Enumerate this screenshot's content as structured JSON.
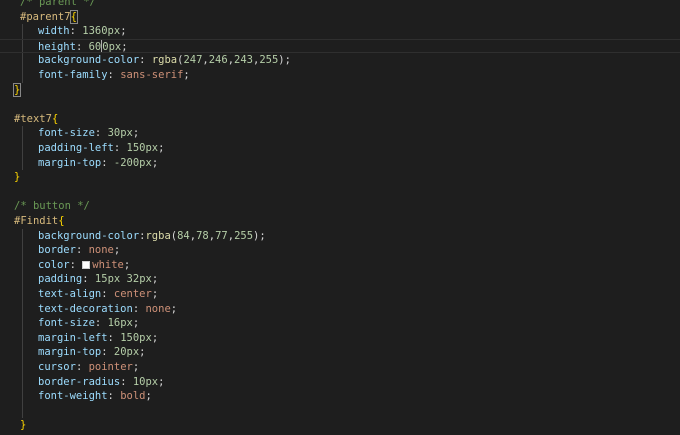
{
  "editor": {
    "lines": [
      {
        "tokens": [
          {
            "t": "/* ",
            "c": "cmt"
          },
          {
            "t": "parent",
            "c": "cmt"
          },
          {
            "t": " */",
            "c": "cmt"
          }
        ]
      },
      {
        "tokens": [
          {
            "t": "#parent7",
            "c": "sel"
          },
          {
            "t": "{",
            "c": "brace"
          }
        ]
      },
      {
        "tokens": [
          {
            "t": "width",
            "c": "prop"
          },
          {
            "t": ": ",
            "c": "punc"
          },
          {
            "t": "1360px",
            "c": "num"
          },
          {
            "t": ";",
            "c": "punc"
          }
        ]
      },
      {
        "tokens": [
          {
            "t": "height",
            "c": "prop"
          },
          {
            "t": ": ",
            "c": "punc"
          },
          {
            "t": "60",
            "c": "num"
          },
          {
            "t": "0px",
            "c": "num"
          },
          {
            "t": ";",
            "c": "punc"
          }
        ]
      },
      {
        "tokens": [
          {
            "t": "background-color",
            "c": "prop"
          },
          {
            "t": ": ",
            "c": "punc"
          },
          {
            "t": "rgba",
            "c": "fn"
          },
          {
            "t": "(",
            "c": "punc"
          },
          {
            "t": "247",
            "c": "num"
          },
          {
            "t": ",",
            "c": "punc"
          },
          {
            "t": "246",
            "c": "num"
          },
          {
            "t": ",",
            "c": "punc"
          },
          {
            "t": "243",
            "c": "num"
          },
          {
            "t": ",",
            "c": "punc"
          },
          {
            "t": "255",
            "c": "num"
          },
          {
            "t": ");",
            "c": "punc"
          }
        ]
      },
      {
        "tokens": [
          {
            "t": "font-family",
            "c": "prop"
          },
          {
            "t": ": ",
            "c": "punc"
          },
          {
            "t": "sans-serif",
            "c": "val"
          },
          {
            "t": ";",
            "c": "punc"
          }
        ]
      },
      {
        "tokens": [
          {
            "t": "}",
            "c": "brace"
          }
        ]
      },
      {
        "tokens": []
      },
      {
        "tokens": [
          {
            "t": "#text7",
            "c": "sel"
          },
          {
            "t": "{",
            "c": "brace"
          }
        ]
      },
      {
        "tokens": [
          {
            "t": "font-size",
            "c": "prop"
          },
          {
            "t": ": ",
            "c": "punc"
          },
          {
            "t": "30px",
            "c": "num"
          },
          {
            "t": ";",
            "c": "punc"
          }
        ]
      },
      {
        "tokens": [
          {
            "t": "padding-left",
            "c": "prop"
          },
          {
            "t": ": ",
            "c": "punc"
          },
          {
            "t": "150px",
            "c": "num"
          },
          {
            "t": ";",
            "c": "punc"
          }
        ]
      },
      {
        "tokens": [
          {
            "t": "margin-top",
            "c": "prop"
          },
          {
            "t": ": ",
            "c": "punc"
          },
          {
            "t": "-200px",
            "c": "num"
          },
          {
            "t": ";",
            "c": "punc"
          }
        ]
      },
      {
        "tokens": [
          {
            "t": "}",
            "c": "brace"
          }
        ]
      },
      {
        "tokens": []
      },
      {
        "tokens": [
          {
            "t": "/* button */",
            "c": "cmt"
          }
        ]
      },
      {
        "tokens": [
          {
            "t": "#Findit",
            "c": "sel"
          },
          {
            "t": "{",
            "c": "brace"
          }
        ]
      },
      {
        "tokens": [
          {
            "t": "background-color",
            "c": "prop"
          },
          {
            "t": ":",
            "c": "punc"
          },
          {
            "t": "rgba",
            "c": "fn"
          },
          {
            "t": "(",
            "c": "punc"
          },
          {
            "t": "84",
            "c": "num"
          },
          {
            "t": ",",
            "c": "punc"
          },
          {
            "t": "78",
            "c": "num"
          },
          {
            "t": ",",
            "c": "punc"
          },
          {
            "t": "77",
            "c": "num"
          },
          {
            "t": ",",
            "c": "punc"
          },
          {
            "t": "255",
            "c": "num"
          },
          {
            "t": ");",
            "c": "punc"
          }
        ]
      },
      {
        "tokens": [
          {
            "t": "border",
            "c": "prop"
          },
          {
            "t": ": ",
            "c": "punc"
          },
          {
            "t": "none",
            "c": "val"
          },
          {
            "t": ";",
            "c": "punc"
          }
        ]
      },
      {
        "tokens": [
          {
            "t": "color",
            "c": "prop"
          },
          {
            "t": ": ",
            "c": "punc"
          },
          {
            "t": "white",
            "c": "val"
          },
          {
            "t": ";",
            "c": "punc"
          }
        ]
      },
      {
        "tokens": [
          {
            "t": "padding",
            "c": "prop"
          },
          {
            "t": ": ",
            "c": "punc"
          },
          {
            "t": "15px",
            "c": "num"
          },
          {
            "t": " ",
            "c": "punc"
          },
          {
            "t": "32px",
            "c": "num"
          },
          {
            "t": ";",
            "c": "punc"
          }
        ]
      },
      {
        "tokens": [
          {
            "t": "text-align",
            "c": "prop"
          },
          {
            "t": ": ",
            "c": "punc"
          },
          {
            "t": "center",
            "c": "val"
          },
          {
            "t": ";",
            "c": "punc"
          }
        ]
      },
      {
        "tokens": [
          {
            "t": "text-decoration",
            "c": "prop"
          },
          {
            "t": ": ",
            "c": "punc"
          },
          {
            "t": "none",
            "c": "val"
          },
          {
            "t": ";",
            "c": "punc"
          }
        ]
      },
      {
        "tokens": [
          {
            "t": "font-size",
            "c": "prop"
          },
          {
            "t": ": ",
            "c": "punc"
          },
          {
            "t": "16px",
            "c": "num"
          },
          {
            "t": ";",
            "c": "punc"
          }
        ]
      },
      {
        "tokens": [
          {
            "t": "margin-left",
            "c": "prop"
          },
          {
            "t": ": ",
            "c": "punc"
          },
          {
            "t": "150px",
            "c": "num"
          },
          {
            "t": ";",
            "c": "punc"
          }
        ]
      },
      {
        "tokens": [
          {
            "t": "margin-top",
            "c": "prop"
          },
          {
            "t": ": ",
            "c": "punc"
          },
          {
            "t": "20px",
            "c": "num"
          },
          {
            "t": ";",
            "c": "punc"
          }
        ]
      },
      {
        "tokens": [
          {
            "t": "cursor",
            "c": "prop"
          },
          {
            "t": ": ",
            "c": "punc"
          },
          {
            "t": "pointer",
            "c": "val"
          },
          {
            "t": ";",
            "c": "punc"
          }
        ]
      },
      {
        "tokens": [
          {
            "t": "border-radius",
            "c": "prop"
          },
          {
            "t": ": ",
            "c": "punc"
          },
          {
            "t": "10px",
            "c": "num"
          },
          {
            "t": ";",
            "c": "punc"
          }
        ]
      },
      {
        "tokens": [
          {
            "t": "font-weight",
            "c": "prop"
          },
          {
            "t": ": ",
            "c": "punc"
          },
          {
            "t": "bold",
            "c": "val"
          },
          {
            "t": ";",
            "c": "punc"
          }
        ]
      },
      {
        "tokens": []
      },
      {
        "tokens": [
          {
            "t": "}",
            "c": "brace"
          }
        ]
      }
    ],
    "swatches": [
      {
        "line": 18,
        "color": "#ffffff"
      }
    ],
    "colors": {
      "background": "#1e1e1e",
      "selector": "#d7ba7d",
      "property": "#9cdcfe",
      "number": "#b5cea8",
      "function": "#dcdcaa",
      "string_value": "#ce9178",
      "comment": "#6a9955",
      "bracket": "#ffd700"
    }
  }
}
